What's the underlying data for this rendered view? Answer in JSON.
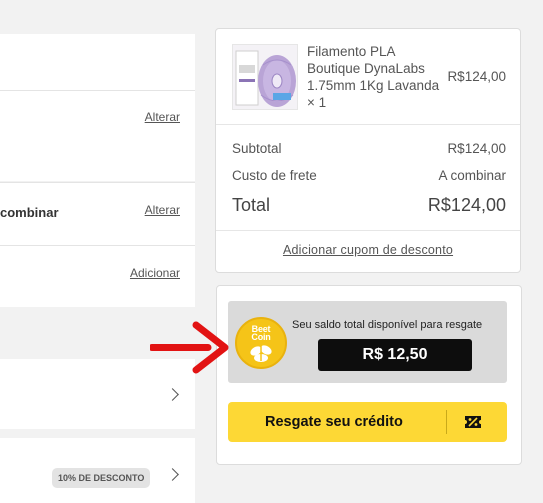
{
  "left": {
    "row1_link": "Alterar",
    "row2_text": "combinar",
    "row2_link": "Alterar",
    "row3_link": "Adicionar",
    "discount_badge": "10% DE DESCONTO"
  },
  "summary": {
    "product": {
      "name": "Filamento PLA Boutique DynaLabs 1.75mm 1Kg Lavanda × 1",
      "price": "R$124,00",
      "thumbnail_icon": "filament-spool-image"
    },
    "subtotal_label": "Subtotal",
    "subtotal_value": "R$124,00",
    "shipping_label": "Custo de frete",
    "shipping_value": "A combinar",
    "total_label": "Total",
    "total_value": "R$124,00",
    "coupon_link": "Adicionar cupom de desconto"
  },
  "rewards": {
    "coin_text_line1": "Beet",
    "coin_text_line2": "Coin",
    "balance_label": "Seu saldo total disponível para resgate",
    "balance_value": "R$ 12,50",
    "redeem_button": "Resgate seu crédito"
  },
  "colors": {
    "accent_yellow": "#fdd835",
    "arrow_red": "#e21313",
    "balance_bg": "#0d0d0d"
  }
}
